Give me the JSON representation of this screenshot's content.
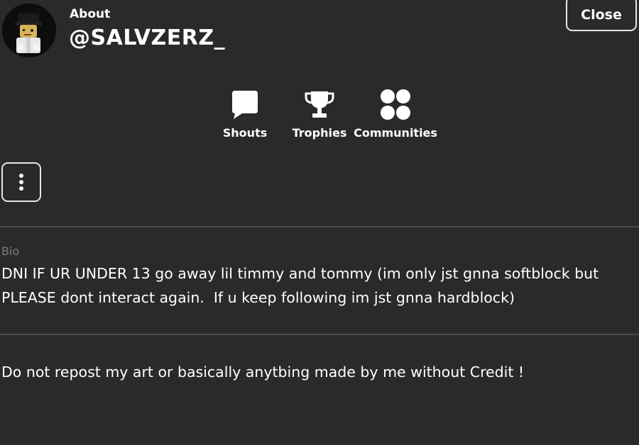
{
  "header": {
    "about_label": "About",
    "username": "@SALVZERZ_",
    "close_label": "Close"
  },
  "nav": {
    "items": [
      {
        "label": "Shouts",
        "icon": "chat-bubble-icon"
      },
      {
        "label": "Trophies",
        "icon": "trophy-icon"
      },
      {
        "label": "Communities",
        "icon": "communities-icon"
      }
    ]
  },
  "more_button": {
    "icon": "more-vertical-icon"
  },
  "bio": {
    "label": "Bio",
    "text": "DNI IF UR UNDER 13 go away lil timmy and tommy (im only jst gnna softblock but PLEASE dont interact again.  If u keep following im jst gnna hardblock)",
    "text_2": "Do not repost my art or basically anytbing made by me without Credit !"
  },
  "colors": {
    "background": "#2a2a2b",
    "text": "#ffffff",
    "muted": "#7d7d7e",
    "divider": "#4a4a4b",
    "border": "#e6e6e6"
  }
}
